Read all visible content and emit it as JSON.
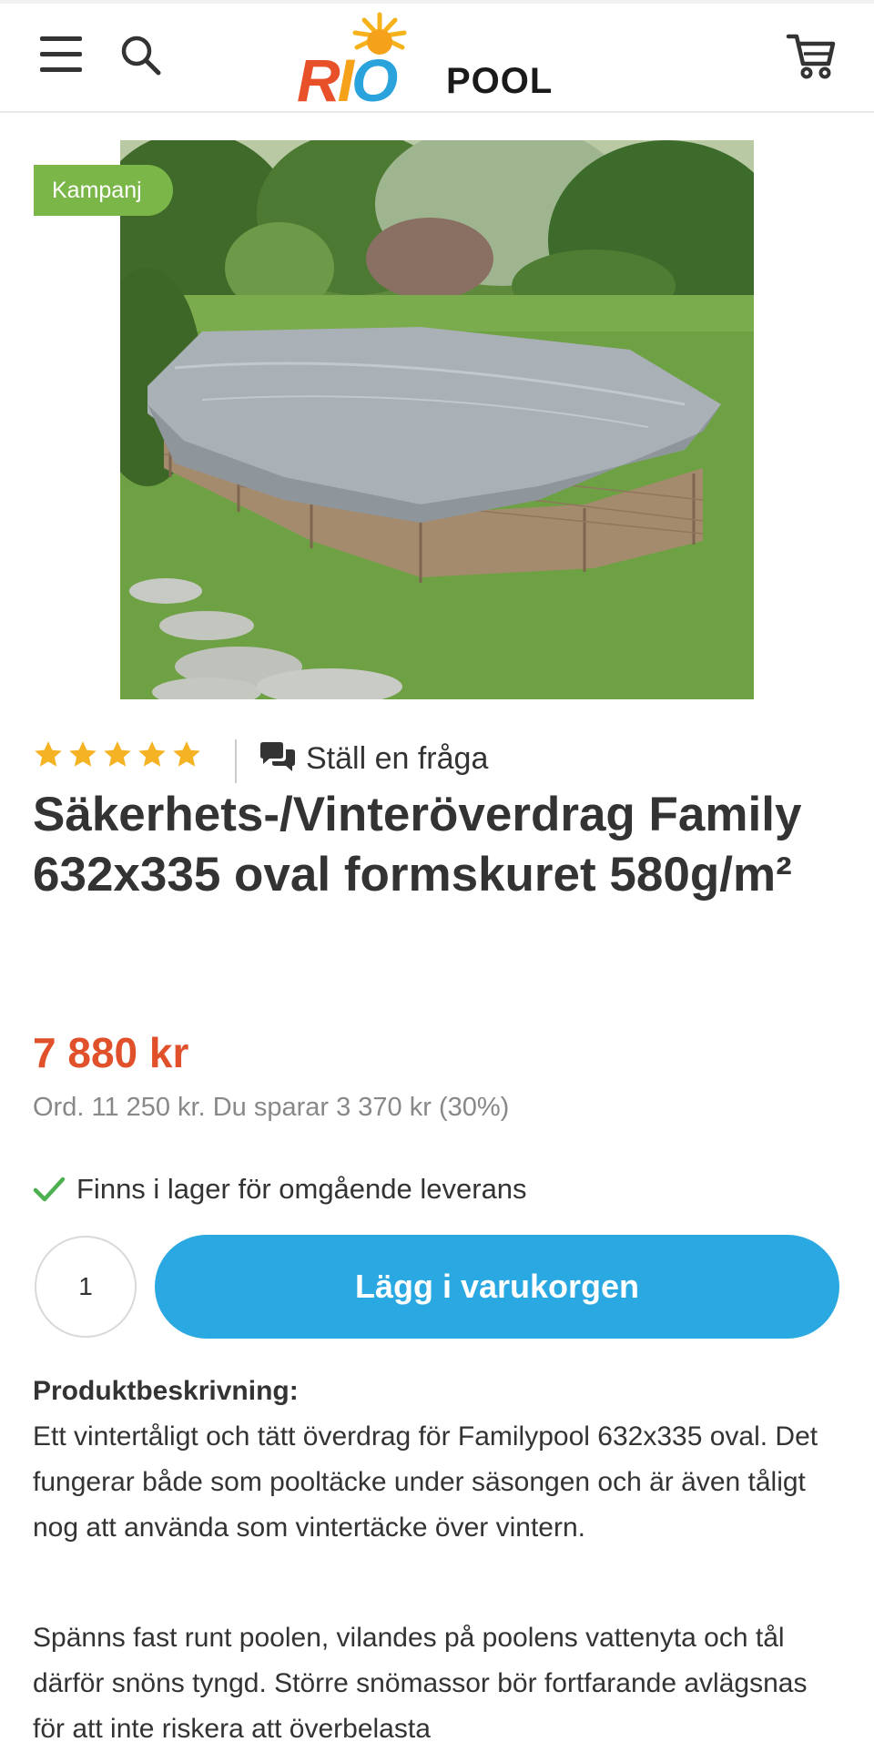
{
  "header": {
    "logo_rio": [
      "R",
      "I",
      "O"
    ],
    "logo_pool": "POOL"
  },
  "product": {
    "badge": "Kampanj",
    "rating_stars": 5,
    "ask_question": "Ställ en fråga",
    "title": "Säkerhets-/Vinteröverdrag Family 632x335 oval formskuret 580g/m²",
    "price": "7 880 kr",
    "ord_price": "Ord. 11 250 kr. Du sparar 3 370 kr (30%)",
    "stock": "Finns i lager för omgående leverans",
    "quantity": "1",
    "add_to_cart": "Lägg i varukorgen"
  },
  "description": {
    "heading": "Produktbeskrivning:",
    "paragraphs": [
      "Ett vintertåligt och tätt överdrag för Familypool 632x335 oval. Det fungerar både som pooltäcke under säsongen och är även tåligt nog att använda som vintertäcke över vintern.",
      "Spänns fast runt poolen, vilandes på poolens vattenyta och tål därför snöns tyngd. Större snömassor bör fortfarande avlägsnas för att inte riskera att överbelasta"
    ]
  },
  "colors": {
    "accent_blue": "#2aa8e2",
    "price_red": "#e0502a",
    "badge_green": "#7ab648",
    "star_gold": "#f5b324",
    "check_green": "#4caf50"
  }
}
